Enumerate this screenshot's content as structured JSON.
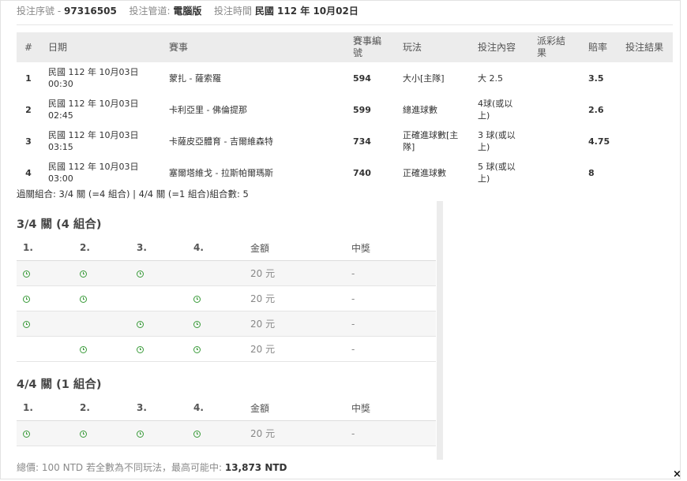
{
  "header": {
    "serial_label": "投注序號",
    "separator": "-",
    "serial_value": "97316505",
    "channel_label": "投注管道:",
    "channel_value": "電腦版",
    "time_label": "投注時間",
    "time_value": "民國 112 年 10月02日"
  },
  "main_table": {
    "headers": [
      "#",
      "日期",
      "賽事",
      "賽事編號",
      "玩法",
      "投注內容",
      "派彩結果",
      "賠率",
      "投注結果"
    ],
    "rows": [
      {
        "no": "1",
        "date": "民國 112 年 10月03日",
        "time": "00:30",
        "match": "蒙扎 - 薩索羅",
        "match_id": "594",
        "play": "大小[主隊]",
        "content": "大 2.5",
        "payout": "",
        "odds": "3.5",
        "result": ""
      },
      {
        "no": "2",
        "date": "民國 112 年 10月03日",
        "time": "02:45",
        "match": "卡利亞里 - 佛倫提那",
        "match_id": "599",
        "play": "總進球數",
        "content": "4球(或以上)",
        "payout": "",
        "odds": "2.6",
        "result": ""
      },
      {
        "no": "3",
        "date": "民國 112 年 10月03日",
        "time": "03:15",
        "match": "卡薩皮亞體育 - 吉爾維森特",
        "match_id": "734",
        "play": "正確進球數[主隊]",
        "content": "3 球(或以上)",
        "payout": "",
        "odds": "4.75",
        "result": ""
      },
      {
        "no": "4",
        "date": "民國 112 年 10月03日",
        "time": "03:00",
        "match": "塞爾塔維戈 - 拉斯帕爾瑪斯",
        "match_id": "740",
        "play": "正確進球數",
        "content": "5 球(或以上)",
        "payout": "",
        "odds": "8",
        "result": ""
      }
    ]
  },
  "combo_summary": "過關組合: 3/4 關 (=4 組合) | 4/4 關 (=1 組合)組合數: 5",
  "sections": [
    {
      "title": "3/4 關 (4 組合)",
      "headers": [
        "1.",
        "2.",
        "3.",
        "4.",
        "金額",
        "中獎"
      ],
      "rows": [
        {
          "legs": [
            true,
            true,
            true,
            false
          ],
          "amount": "20 元",
          "win": "-"
        },
        {
          "legs": [
            true,
            true,
            false,
            true
          ],
          "amount": "20 元",
          "win": "-"
        },
        {
          "legs": [
            true,
            false,
            true,
            true
          ],
          "amount": "20 元",
          "win": "-"
        },
        {
          "legs": [
            false,
            true,
            true,
            true
          ],
          "amount": "20 元",
          "win": "-"
        }
      ]
    },
    {
      "title": "4/4 關 (1 組合)",
      "headers": [
        "1.",
        "2.",
        "3.",
        "4.",
        "金額",
        "中獎"
      ],
      "rows": [
        {
          "legs": [
            true,
            true,
            true,
            true
          ],
          "amount": "20 元",
          "win": "-"
        }
      ]
    }
  ],
  "footer": {
    "total_label": "總價:",
    "total_value": "100 NTD",
    "max_label": "若全數為不同玩法，最高可能中:",
    "max_value": "13,873 NTD"
  },
  "close_glyph": "×",
  "icon_name": "clock-icon",
  "colors": {
    "clock": "#3a9b3a",
    "header_bg": "#ececec"
  }
}
